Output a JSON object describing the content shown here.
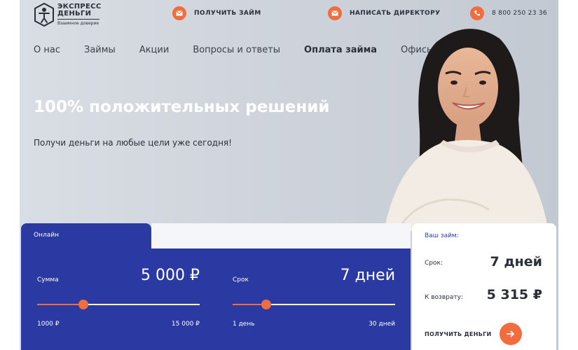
{
  "header": {
    "logo": {
      "line1": "ЭКСПРЕСС",
      "line2": "ДЕНЬГИ",
      "slogan": "Взаимное доверие",
      "icon": "person-figure-logo-icon"
    },
    "actions": [
      {
        "label": "ПОЛУЧИТЬ ЗАЙМ",
        "icon": "envelope-icon"
      },
      {
        "label": "НАПИСАТЬ ДИРЕКТОРУ",
        "icon": "envelope-icon"
      },
      {
        "label": "8 800 250 23 36",
        "icon": "phone-icon"
      }
    ]
  },
  "nav": {
    "items": [
      "О нас",
      "Займы",
      "Акции",
      "Вопросы и ответы",
      "Оплата займа",
      "Офисы"
    ],
    "active_index": 4
  },
  "hero": {
    "headline": "100% положительных решений",
    "subline": "Получи деньги на любые цели уже сегодня!"
  },
  "calculator": {
    "tab_label": "Онлайн",
    "amount": {
      "label": "Сумма",
      "value": "5 000 ₽",
      "min": "1000 ₽",
      "max": "15 000 ₽",
      "fraction": 0.286
    },
    "term": {
      "label": "Срок",
      "value": "7 дней",
      "min": "1 день",
      "max": "30 дней",
      "fraction": 0.207
    }
  },
  "summary": {
    "title": "Ваш займ:",
    "term_label": "Срок:",
    "term_value": "7 дней",
    "return_label": "К возврату:",
    "return_value": "5 315 ₽",
    "cta_label": "ПОЛУЧИТЬ ДЕНЬГИ",
    "cta_icon": "arrow-right-icon"
  },
  "colors": {
    "accent": "#f26d3d",
    "calculator_bg": "#2b3aa3",
    "hero_bg": "#cfd4dc",
    "text_dark": "#2a2f3a"
  }
}
